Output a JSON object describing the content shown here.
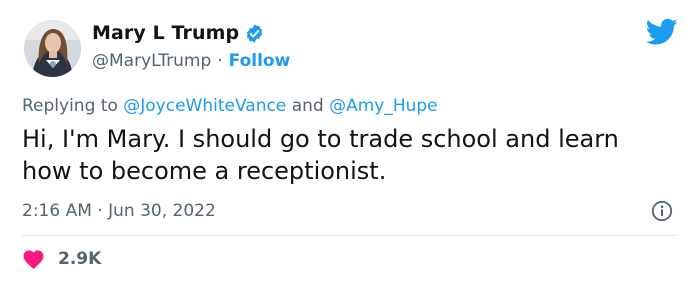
{
  "author": {
    "display_name": "Mary L Trump",
    "handle": "@MaryLTrump",
    "separator": "·",
    "follow_label": "Follow"
  },
  "reply": {
    "prefix": "Replying to",
    "mention_1": "@JoyceWhiteVance",
    "conjunction": "and",
    "mention_2": "@Amy_Hupe"
  },
  "tweet": {
    "text": "Hi, I'm Mary. I should go to trade school and learn how to become a receptionist."
  },
  "meta": {
    "time": "2:16 AM",
    "separator": "·",
    "date": "Jun 30, 2022"
  },
  "engagement": {
    "likes": "2.9K"
  },
  "colors": {
    "brand_blue": "#1d9bf0",
    "heart_pink": "#f91880",
    "muted_text": "#536471"
  },
  "icons": [
    "verified-badge-icon",
    "twitter-bird-icon",
    "info-icon",
    "heart-icon"
  ]
}
